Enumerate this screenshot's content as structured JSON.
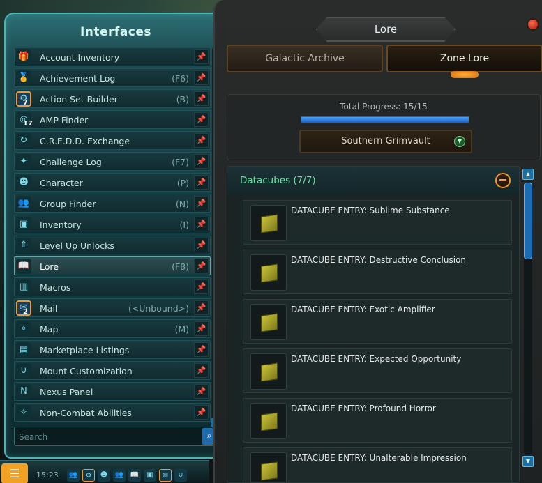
{
  "interfaces_panel": {
    "title": "Interfaces",
    "items": [
      {
        "label": "Account Inventory",
        "key": "",
        "icon": "gift-icon",
        "glyph": "🎁",
        "pinned": true
      },
      {
        "label": "Achievement Log",
        "key": "(F6)",
        "icon": "medal-icon",
        "glyph": "🏅",
        "pinned": false
      },
      {
        "label": "Action Set Builder",
        "key": "(B)",
        "icon": "action-set-icon",
        "glyph": "⚙",
        "pinned": true,
        "highlight": true,
        "badge": "7"
      },
      {
        "label": "AMP Finder",
        "key": "",
        "icon": "amp-icon",
        "glyph": "◎",
        "pinned": false,
        "badge": "17"
      },
      {
        "label": "C.R.E.D.D. Exchange",
        "key": "",
        "icon": "exchange-icon",
        "glyph": "↻",
        "pinned": false
      },
      {
        "label": "Challenge Log",
        "key": "(F7)",
        "icon": "star-icon",
        "glyph": "✦",
        "pinned": false
      },
      {
        "label": "Character",
        "key": "(P)",
        "icon": "character-icon",
        "glyph": "☻",
        "pinned": true
      },
      {
        "label": "Group Finder",
        "key": "(N)",
        "icon": "group-icon",
        "glyph": "👥",
        "pinned": true
      },
      {
        "label": "Inventory",
        "key": "(I)",
        "icon": "bag-icon",
        "glyph": "▣",
        "pinned": false
      },
      {
        "label": "Level Up Unlocks",
        "key": "",
        "icon": "level-up-icon",
        "glyph": "⇑",
        "pinned": false
      },
      {
        "label": "Lore",
        "key": "(F8)",
        "icon": "lore-icon",
        "glyph": "📖",
        "pinned": true,
        "active": true
      },
      {
        "label": "Macros",
        "key": "",
        "icon": "macros-icon",
        "glyph": "▥",
        "pinned": false
      },
      {
        "label": "Mail",
        "key": "(<Unbound>)",
        "icon": "mail-icon",
        "glyph": "✉",
        "pinned": true,
        "highlight": true,
        "badge": "2"
      },
      {
        "label": "Map",
        "key": "(M)",
        "icon": "map-pin-icon",
        "glyph": "⌖",
        "pinned": false
      },
      {
        "label": "Marketplace Listings",
        "key": "",
        "icon": "chart-icon",
        "glyph": "▤",
        "pinned": false
      },
      {
        "label": "Mount Customization",
        "key": "",
        "icon": "horseshoe-icon",
        "glyph": "∪",
        "pinned": false
      },
      {
        "label": "Nexus Panel",
        "key": "",
        "icon": "nexus-icon",
        "glyph": "N",
        "pinned": false
      },
      {
        "label": "Non-Combat Abilities",
        "key": "",
        "icon": "ability-icon",
        "glyph": "✧",
        "pinned": false
      }
    ],
    "search": {
      "placeholder": "Search",
      "value": ""
    }
  },
  "bottom_bar": {
    "clock": "15:23"
  },
  "lore_panel": {
    "title": "Lore",
    "tabs": [
      {
        "label": "Galactic Archive",
        "active": false
      },
      {
        "label": "Zone Lore",
        "active": true
      }
    ],
    "progress": {
      "label": "Total Progress: 15/15",
      "current": 15,
      "total": 15
    },
    "zone_select": {
      "value": "Southern Grimvault"
    },
    "datacubes": {
      "header": "Datacubes (7/7)",
      "entries": [
        "DATACUBE ENTRY: Sublime Substance",
        "DATACUBE ENTRY: Destructive Conclusion",
        "DATACUBE ENTRY: Exotic Amplifier",
        "DATACUBE ENTRY: Expected Opportunity",
        "DATACUBE ENTRY: Profound Horror",
        "DATACUBE ENTRY: Unalterable Impression"
      ]
    }
  },
  "colors": {
    "accent_teal": "#4fb3b4",
    "progress_blue": "#4aa3ff",
    "datacube_header_green": "#6fe0a8",
    "highlight_orange": "#f09a2a"
  }
}
